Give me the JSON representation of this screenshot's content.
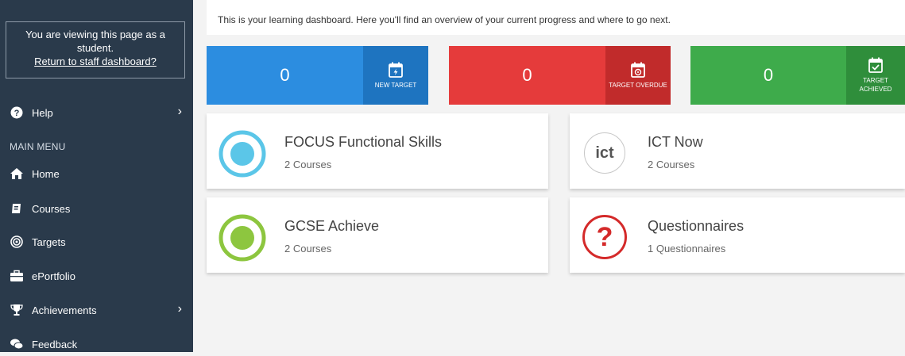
{
  "sidebar": {
    "notice_line1": "You are viewing this page as a",
    "notice_line2": "student.",
    "return_link": "Return to staff dashboard?",
    "help_label": "Help",
    "main_menu_label": "MAIN MENU",
    "items": [
      {
        "label": "Home",
        "icon": "home-icon"
      },
      {
        "label": "Courses",
        "icon": "book-icon"
      },
      {
        "label": "Targets",
        "icon": "target-icon"
      },
      {
        "label": "ePortfolio",
        "icon": "briefcase-icon"
      },
      {
        "label": "Achievements",
        "icon": "trophy-icon"
      },
      {
        "label": "Feedback",
        "icon": "comments-icon"
      }
    ],
    "colors": {
      "bg": "#2a3a4b"
    }
  },
  "main": {
    "intro": "This is your learning dashboard. Here you'll find an overview of your current progress and where to go next.",
    "stats": [
      {
        "value": "0",
        "label": "NEW TARGET",
        "color": "#2c8de0",
        "tag_color": "#1e74c0",
        "icon": "calendar-bolt-icon"
      },
      {
        "value": "0",
        "label": "TARGET OVERDUE",
        "color": "#e53b3b",
        "tag_color": "#c12b2b",
        "icon": "calendar-alert-icon"
      },
      {
        "value": "0",
        "label": "TARGET ACHIEVED",
        "color": "#3eab4b",
        "tag_color": "#2f8e3b",
        "icon": "calendar-check-icon"
      }
    ],
    "cards": [
      {
        "title": "FOCUS Functional Skills",
        "subtitle": "2 Courses",
        "icon": "focus-logo-icon",
        "accent": "#5bc6e8"
      },
      {
        "title": "ICT Now",
        "subtitle": "2 Courses",
        "icon": "ict-logo-icon",
        "logo_text": "ict"
      },
      {
        "title": "GCSE Achieve",
        "subtitle": "2 Courses",
        "icon": "gcse-logo-icon",
        "accent": "#8dc63f"
      },
      {
        "title": "Questionnaires",
        "subtitle": "1 Questionnaires",
        "icon": "question-mark-icon",
        "logo_text": "?",
        "accent": "#d42a2a"
      }
    ]
  }
}
